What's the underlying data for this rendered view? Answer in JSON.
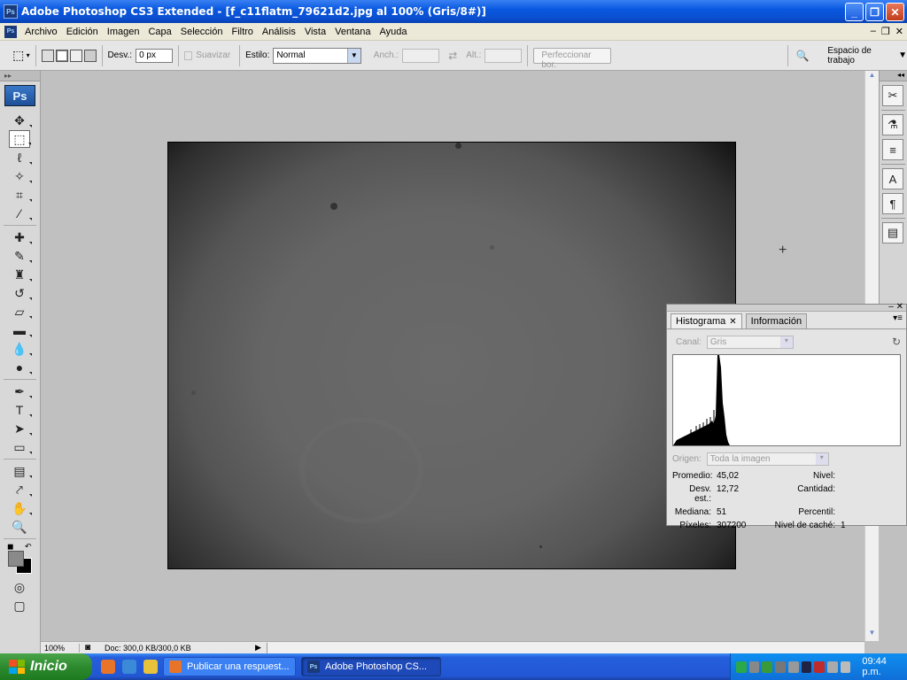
{
  "window": {
    "title": "Adobe Photoshop CS3 Extended - [f_c11flatm_79621d2.jpg al 100% (Gris/8#)]",
    "app_icon": "Ps",
    "buttons": [
      "minimize",
      "restore",
      "close"
    ]
  },
  "menubar": {
    "items": [
      "Archivo",
      "Edición",
      "Imagen",
      "Capa",
      "Selección",
      "Filtro",
      "Análisis",
      "Vista",
      "Ventana",
      "Ayuda"
    ]
  },
  "options": {
    "desv_label": "Desv.:",
    "desv_value": "0 px",
    "suavizar_label": "Suavizar",
    "estilo_label": "Estilo:",
    "estilo_value": "Normal",
    "anch_label": "Anch.:",
    "alt_label": "Alt.:",
    "refine_label": "Perfeccionar bor.",
    "workspace_label": "Espacio de trabajo"
  },
  "toolbox": {
    "logo": "Ps"
  },
  "histogram_panel": {
    "tabs": [
      "Histograma",
      "Información"
    ],
    "canal_label": "Canal:",
    "canal_value": "Gris",
    "origen_label": "Origen:",
    "origen_value": "Toda la imagen",
    "stats": {
      "promedio_label": "Promedio:",
      "promedio_value": "45,02",
      "desv_label": "Desv. est.:",
      "desv_value": "12,72",
      "mediana_label": "Mediana:",
      "mediana_value": "51",
      "pixeles_label": "Píxeles:",
      "pixeles_value": "307200",
      "nivel_label": "Nivel:",
      "cantidad_label": "Cantidad:",
      "percentil_label": "Percentil:",
      "cache_label": "Nivel de caché:",
      "cache_value": "1"
    }
  },
  "statusbar": {
    "zoom": "100%",
    "doc": "Doc: 300,0 KB/300,0 KB"
  },
  "taskbar": {
    "start_label": "Inicio",
    "tasks": [
      "Publicar una respuest...",
      "Adobe Photoshop CS..."
    ],
    "clock": "09:44 p.m."
  },
  "colors": {
    "title_blue": "#0a58e0",
    "taskbar_blue": "#245edb",
    "start_green": "#2e8a2e"
  }
}
